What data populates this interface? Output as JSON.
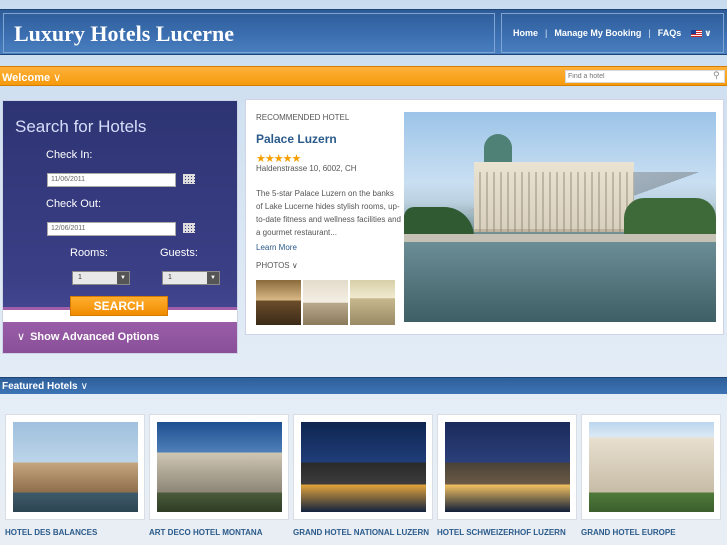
{
  "header": {
    "site_title": "Luxury Hotels Lucerne",
    "nav": [
      "Home",
      "Manage My Booking",
      "FAQs"
    ],
    "nav_separator": "|",
    "flag_icon": "us-flag-icon",
    "language_chevron": "∨"
  },
  "welcome": {
    "label": "Welcome",
    "chevron": "∨",
    "find_placeholder": "Find a hotel",
    "find_icon": "⚲"
  },
  "search": {
    "title": "Search for Hotels",
    "checkin_label": "Check In:",
    "checkin_value": "11/06/2011",
    "checkout_label": "Check Out:",
    "checkout_value": "12/06/2011",
    "rooms_label": "Rooms:",
    "rooms_value": "1",
    "guests_label": "Guests:",
    "guests_value": "1",
    "select_arrow": "▼",
    "button_label": "SEARCH",
    "advanced_label": "Show Advanced Options",
    "advanced_chevron": "∨"
  },
  "recommended": {
    "kicker": "RECOMMENDED HOTEL",
    "name": "Palace Luzern",
    "stars": "★★★★★",
    "rating": 5,
    "address": "Haldenstrasse 10, 6002, CH",
    "description": "The 5-star Palace Luzern on the banks of Lake Lucerne hides stylish rooms, up-to-date fitness and wellness facilities and a gourmet restaurant...",
    "learn_more": "Learn More",
    "photos_label": "PHOTOS",
    "photos_chevron": "∨"
  },
  "featured": {
    "label": "Featured Hotels",
    "chevron": "∨",
    "hotels": [
      {
        "name": "HOTEL DES BALANCES"
      },
      {
        "name": "ART DECO HOTEL MONTANA"
      },
      {
        "name": "GRAND HOTEL NATIONAL LUZERN"
      },
      {
        "name": "HOTEL SCHWEIZERHOF LUZERN"
      },
      {
        "name": "GRAND HOTEL EUROPE"
      }
    ]
  }
}
